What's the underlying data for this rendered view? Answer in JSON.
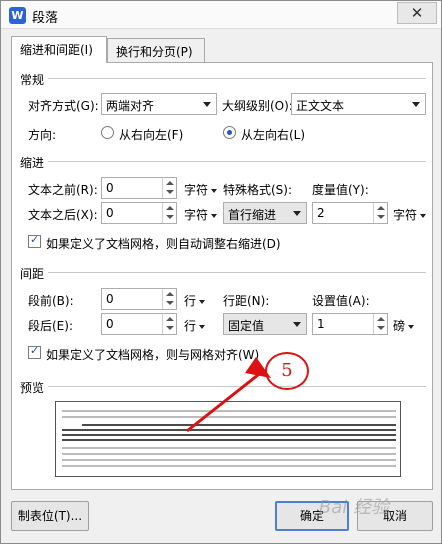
{
  "window": {
    "title": "段落",
    "app_icon": "W",
    "close_glyph": "✕"
  },
  "tabs": [
    {
      "label": "缩进和间距(I)"
    },
    {
      "label": "换行和分页(P)"
    }
  ],
  "general": {
    "heading": "常规",
    "alignment_label": "对齐方式(G):",
    "alignment_value": "两端对齐",
    "outline_label": "大纲级别(O):",
    "outline_value": "正文文本",
    "direction_label": "方向:",
    "rtl_label": "从右向左(F)",
    "ltr_label": "从左向右(L)",
    "ltr_selected": true
  },
  "indent": {
    "heading": "缩进",
    "before_label": "文本之前(R):",
    "before_value": "0",
    "before_unit": "字符",
    "after_label": "文本之后(X):",
    "after_value": "0",
    "after_unit": "字符",
    "special_label": "特殊格式(S):",
    "special_value": "首行缩进",
    "measure_label": "度量值(Y):",
    "measure_value": "2",
    "measure_unit": "字符",
    "grid_check_label": "如果定义了文档网格，则自动调整右缩进(D)",
    "grid_checked": true
  },
  "spacing": {
    "heading": "间距",
    "before_label": "段前(B):",
    "before_value": "0",
    "before_unit": "行",
    "after_label": "段后(E):",
    "after_value": "0",
    "after_unit": "行",
    "line_label": "行距(N):",
    "line_value": "固定值",
    "set_label": "设置值(A):",
    "set_value": "1",
    "set_unit": "磅",
    "grid_check_label": "如果定义了文档网格，则与网格对齐(W)",
    "grid_checked": true
  },
  "preview": {
    "heading": "预览"
  },
  "buttons": {
    "tabs": "制表位(T)...",
    "ok": "确定",
    "cancel": "取消"
  },
  "annotation": {
    "number": "5",
    "color": "#dd1111"
  },
  "watermark": "Bai 经验"
}
